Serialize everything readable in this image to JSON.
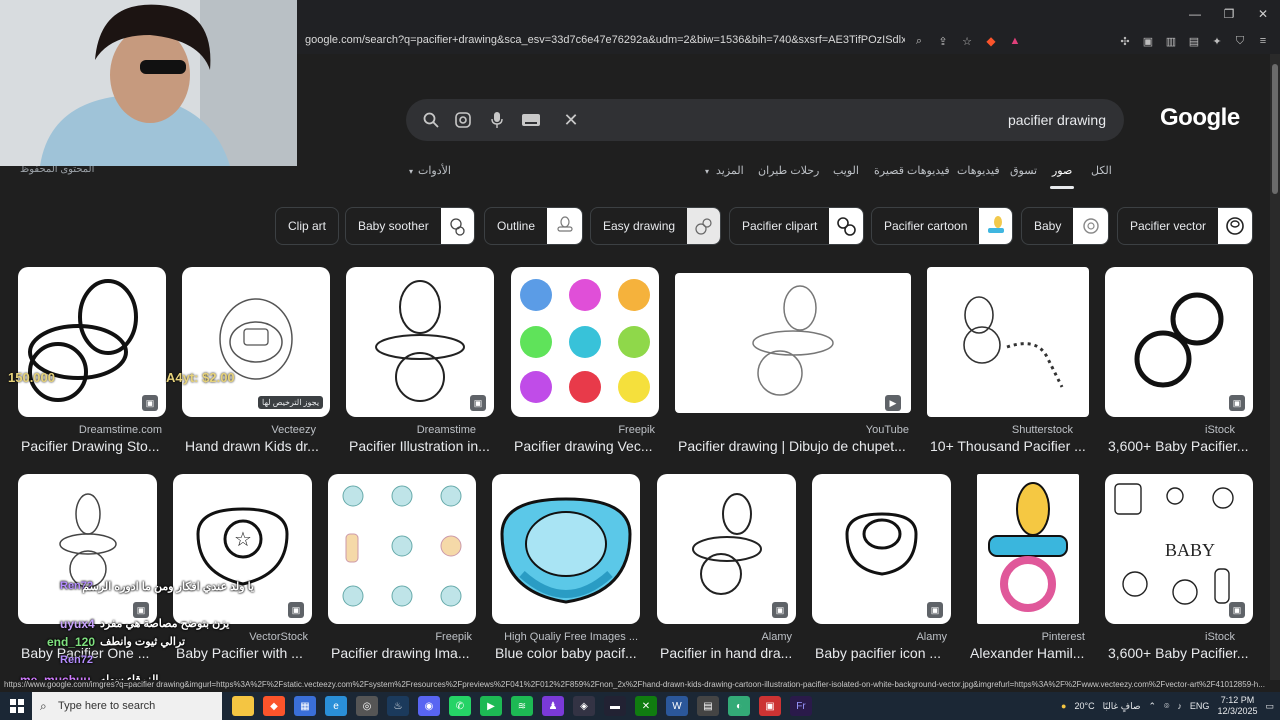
{
  "browser": {
    "url": "google.com/search?q=pacifier+drawing&sca_esv=33d7c6e47e76292a&udm=2&biw=1536&bih=740&sxsrf=AE3TifPOzISdlxv_T6GjCdLfY4kFPx...",
    "window_controls": [
      "—",
      "❐",
      "✕"
    ]
  },
  "search": {
    "query": "pacifier drawing",
    "logo": "Google"
  },
  "tabs": {
    "all": "الكل",
    "images": "صور",
    "shopping": "تسوق",
    "videos": "فيديوهات",
    "short_videos": "فيديوهات قصيرة",
    "web": "الويب",
    "flights": "رحلات طيران",
    "more": "المزيد",
    "tools": "الأدوات",
    "saved": "المحتوى المحفوظ"
  },
  "chips": [
    {
      "label": "Clip art"
    },
    {
      "label": "Baby soother"
    },
    {
      "label": "Outline"
    },
    {
      "label": "Easy drawing"
    },
    {
      "label": "Pacifier clipart"
    },
    {
      "label": "Pacifier cartoon"
    },
    {
      "label": "Baby"
    },
    {
      "label": "Pacifier vector"
    }
  ],
  "results": [
    {
      "source": "Dreamstime.com",
      "title": "Pacifier Drawing Sto..."
    },
    {
      "source": "Vecteezy",
      "title": "Hand drawn Kids dr...",
      "price_tag": "يجوز الترخيص لها"
    },
    {
      "source": "Dreamstime",
      "title": "Pacifier Illustration in..."
    },
    {
      "source": "Freepik",
      "title": "Pacifier drawing Vec..."
    },
    {
      "source": "YouTube",
      "title": "Pacifier drawing | Dibujo de chupet..."
    },
    {
      "source": "Shutterstock",
      "title": "10+ Thousand Pacifier ..."
    },
    {
      "source": "iStock",
      "title": "3,600+ Baby Pacifier..."
    },
    {
      "source": "",
      "title": "Baby Pacifier One ..."
    },
    {
      "source": "VectorStock",
      "title": "Baby Pacifier with ..."
    },
    {
      "source": "Freepik",
      "title": "Pacifier drawing Ima..."
    },
    {
      "source": "High Qualiy Free Images ...",
      "title": "Blue color baby pacif..."
    },
    {
      "source": "Alamy",
      "title": "Pacifier in hand dra..."
    },
    {
      "source": "Alamy",
      "title": "Baby pacifier icon ..."
    },
    {
      "source": "Pinterest",
      "title": "Alexander Hamil..."
    },
    {
      "source": "iStock",
      "title": "3,600+ Baby Pacifier..."
    }
  ],
  "overlay": {
    "prices": [
      "150.000",
      "A4yt: $2.00"
    ],
    "chat": [
      {
        "user": "Ren72",
        "text": "يا ولد عندي افكار ومن ما ادوره الرسم",
        "color": "#b48cff"
      },
      {
        "user": "uyux4",
        "text": "يزن بتوضح مصاصة هي مفرد",
        "color": "#c9a3ff"
      },
      {
        "user": "end_120",
        "text": "ترالي ثيوت وانطف",
        "color": "#7fe07f"
      },
      {
        "user": "Ren72",
        "text": "",
        "color": "#b48cff"
      },
      {
        "user": "me_muchuu",
        "text": "الزرقاء سهله",
        "color": "#d07cff"
      }
    ]
  },
  "status_url": "https://www.google.com/imgres?q=pacifier drawing&imgurl=https%3A%2F%2Fstatic.vecteezy.com%2Fsystem%2Fresources%2Fpreviews%2F041%2F012%2F859%2Fnon_2x%2Fhand-drawn-kids-drawing-cartoon-illustration-pacifier-isolated-on-white-background-vector.jpg&imgrefurl=https%3A%2F%2Fwww.vecteezy.com%2Fvector-art%2F41012859-h...",
  "taskbar": {
    "search_placeholder": "Type here to search",
    "weather": "20°C",
    "weather_text": "صافٍ غالبًا",
    "lang": "ENG",
    "time": "7:12 PM",
    "date": "12/3/2025"
  }
}
